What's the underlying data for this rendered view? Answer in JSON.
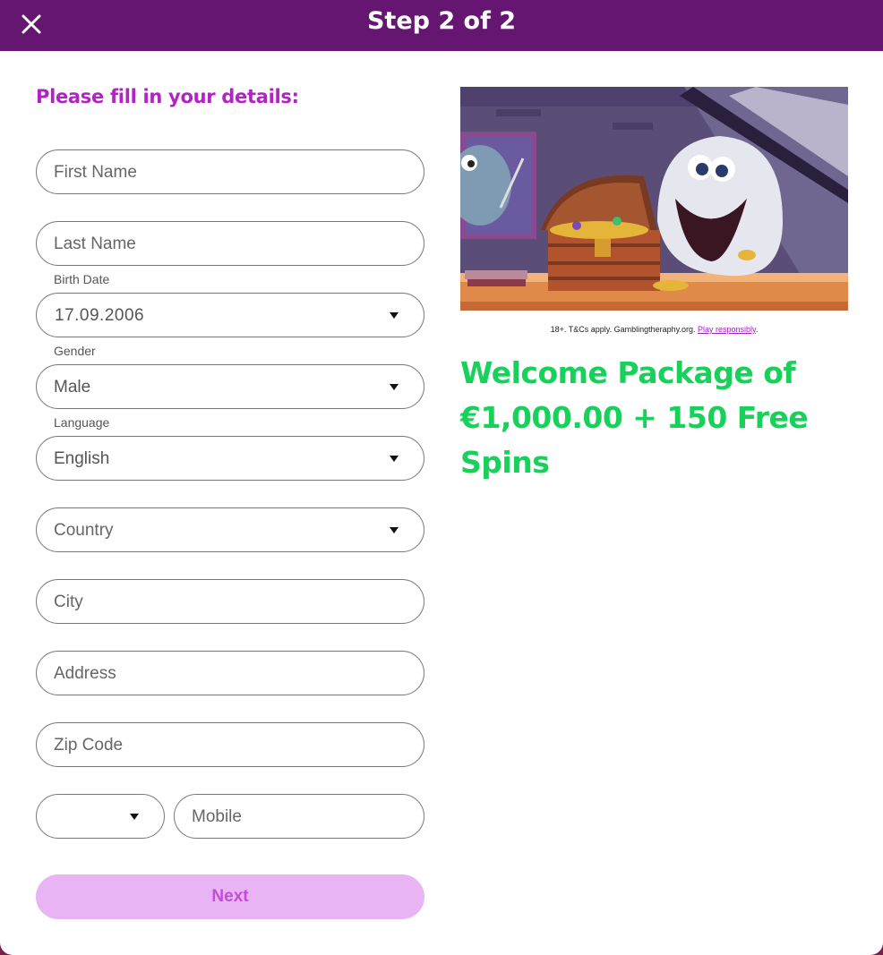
{
  "header": {
    "title": "Step 2 of 2",
    "close_icon": "close-icon"
  },
  "form": {
    "heading": "Please fill in your details:",
    "first_name": {
      "placeholder": "First Name"
    },
    "last_name": {
      "placeholder": "Last Name"
    },
    "birth_date": {
      "label": "Birth Date",
      "value": "17.09.2006"
    },
    "gender": {
      "label": "Gender",
      "value": "Male"
    },
    "language": {
      "label": "Language",
      "value": "English"
    },
    "country": {
      "placeholder": "Country"
    },
    "city": {
      "placeholder": "City"
    },
    "address": {
      "placeholder": "Address"
    },
    "zip": {
      "placeholder": "Zip Code"
    },
    "phone_code": {
      "value": ""
    },
    "mobile": {
      "placeholder": "Mobile"
    },
    "next_label": "Next"
  },
  "promo": {
    "tos_text": "18+. T&Cs apply. Gamblingtheraphy.org. ",
    "tos_link": "Play responsibly",
    "tos_end": ".",
    "title": "Welcome Package of €1,000.00 + 150 Free Spins"
  },
  "colors": {
    "header_bg": "#651670",
    "heading": "#b222c4",
    "button_bg": "#e8b4f3",
    "button_text": "#c44dd8",
    "promo_title": "#17d15a"
  }
}
